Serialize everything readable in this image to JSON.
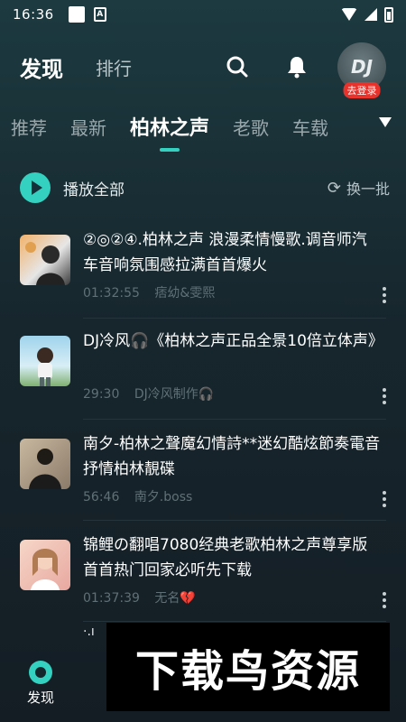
{
  "status": {
    "time": "16:36",
    "small_icon_label": "A"
  },
  "header": {
    "tab_active": "发现",
    "tab_other": "排行",
    "avatar_text": "DJ",
    "login_badge": "去登录"
  },
  "categories": [
    "推荐",
    "最新",
    "柏林之声",
    "老歌",
    "车载"
  ],
  "active_category": "柏林之声",
  "play_all": {
    "label": "播放全部",
    "refresh_label": "换一批"
  },
  "songs": [
    {
      "title": "②◎②④.柏林之声 浪漫柔情慢歌.调音师汽车音响氛围感拉满首首爆火",
      "duration": "01:32:55",
      "author": "痞幼&雯熙"
    },
    {
      "title": "DJ冷风🎧《柏林之声正品全景10倍立体声》",
      "duration": "29:30",
      "author": "DJ冷风制作🎧"
    },
    {
      "title": "南夕-柏林之聲魔幻情詩**迷幻酷炫節奏電音抒情柏林靚碟",
      "duration": "56:46",
      "author": "南夕.boss"
    },
    {
      "title": "锦鲤の翻唱7080经典老歌柏林之声尊享版首首热门回家必听先下载",
      "duration": "01:37:39",
      "author": "无名💔"
    }
  ],
  "partial_row_text": "·.ı",
  "bottom_nav": {
    "find_label": "发现"
  },
  "watermark": "下载鸟资源",
  "colors": {
    "accent": "#35d1c0",
    "badge": "#e8322c",
    "background_top": "#1c3a40",
    "background_bottom": "#141d24"
  }
}
